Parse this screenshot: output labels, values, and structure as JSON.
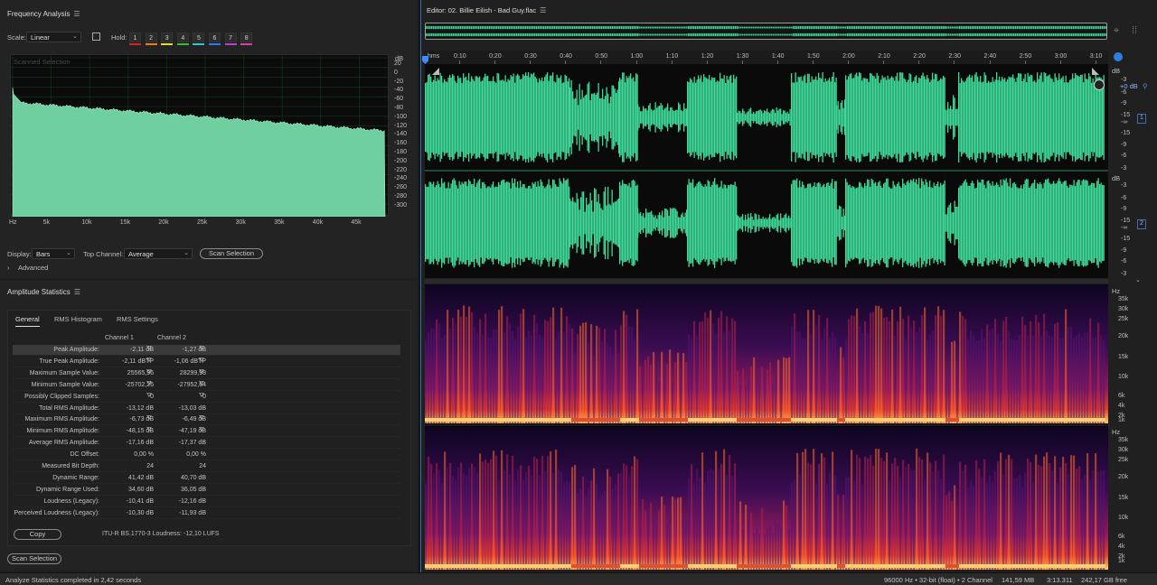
{
  "freq_panel": {
    "title": "Frequency Analysis",
    "scale_label": "Scale:",
    "scale_value": "Linear",
    "hold_label": "Hold:",
    "hold_buttons": [
      "1",
      "2",
      "3",
      "4",
      "5",
      "6",
      "7",
      "8"
    ],
    "hold_colors": [
      "#e02020",
      "#f07d10",
      "#e8e020",
      "#30c030",
      "#2ec8c8",
      "#2e78f0",
      "#c03ce0",
      "#e03ca8"
    ],
    "graph_overlay": "Scanned Selection",
    "db_unit": "dB",
    "db_ticks": [
      "20",
      "0",
      "-20",
      "-40",
      "-60",
      "-80",
      "-100",
      "-120",
      "-140",
      "-160",
      "-180",
      "-200",
      "-220",
      "-240",
      "-260",
      "-280",
      "-300"
    ],
    "freq_ticks": [
      "Hz",
      "5k",
      "10k",
      "15k",
      "20k",
      "25k",
      "30k",
      "35k",
      "40k",
      "45k"
    ],
    "display_label": "Display:",
    "display_value": "Bars",
    "top_channel_label": "Top Channel:",
    "top_channel_value": "Average",
    "scan_button": "Scan Selection",
    "advanced_label": "Advanced"
  },
  "amp_panel": {
    "title": "Amplitude Statistics",
    "tabs": [
      "General",
      "RMS Histogram",
      "RMS Settings"
    ],
    "col1": "Channel 1",
    "col2": "Channel 2",
    "rows": [
      {
        "label": "Peak Amplitude:",
        "c1": "-2,11 dB",
        "c2": "-1,27 dB",
        "arrow": true
      },
      {
        "label": "True Peak Amplitude:",
        "c1": "-2,11 dBTP",
        "c2": "-1,06 dBTP",
        "arrow": true
      },
      {
        "label": "Maximum Sample Value:",
        "c1": "25565,96",
        "c2": "28299,98",
        "arrow": true
      },
      {
        "label": "Minimum Sample Value:",
        "c1": "-25702,26",
        "c2": "-27952,64",
        "arrow": true
      },
      {
        "label": "Possibly Clipped Samples:",
        "c1": "0",
        "c2": "0",
        "arrow": true
      },
      {
        "label": "Total RMS Amplitude:",
        "c1": "-13,12 dB",
        "c2": "-13,03 dB",
        "arrow": false
      },
      {
        "label": "Maximum RMS Amplitude:",
        "c1": "-6,73 dB",
        "c2": "-6,49 dB",
        "arrow": true
      },
      {
        "label": "Minimum RMS Amplitude:",
        "c1": "-48,15 dB",
        "c2": "-47,19 dB",
        "arrow": true
      },
      {
        "label": "Average RMS Amplitude:",
        "c1": "-17,16 dB",
        "c2": "-17,37 dB",
        "arrow": false
      },
      {
        "label": "DC Offset:",
        "c1": "0,00 %",
        "c2": "0,00 %",
        "arrow": false
      },
      {
        "label": "Measured Bit Depth:",
        "c1": "24",
        "c2": "24",
        "arrow": false
      },
      {
        "label": "Dynamic Range:",
        "c1": "41,42 dB",
        "c2": "40,70 dB",
        "arrow": false
      },
      {
        "label": "Dynamic Range Used:",
        "c1": "34,60 dB",
        "c2": "36,05 dB",
        "arrow": false
      },
      {
        "label": "Loudness (Legacy):",
        "c1": "-10,41 dB",
        "c2": "-12,16 dB",
        "arrow": false
      },
      {
        "label": "Perceived Loudness (Legacy):",
        "c1": "-10,30 dB",
        "c2": "-11,93 dB",
        "arrow": false
      }
    ],
    "copy_button": "Copy",
    "loudness_text": "ITU-R BS.1770-3 Loudness: -12,10 LUFS",
    "scan_button": "Scan Selection"
  },
  "editor": {
    "title": "Editor: 02. Billie Eilish - Bad Guy.flac",
    "time_ticks": [
      "hms",
      "0:10",
      "0:20",
      "0:30",
      "0:40",
      "0:50",
      "1:00",
      "1:10",
      "1:20",
      "1:30",
      "1:40",
      "1:50",
      "2:00",
      "2:10",
      "2:20",
      "2:30",
      "2:40",
      "2:50",
      "3:00",
      "3:10"
    ],
    "amp_unit": "dB",
    "amp_ticks": [
      "-3",
      "-6",
      "-9",
      "-15",
      "-∞",
      "-15",
      "-9",
      "-6",
      "-3"
    ],
    "gain_value": "+0 dB",
    "channel_badges": [
      "1",
      "2"
    ],
    "hz_unit": "Hz",
    "spec_ticks": [
      "35k",
      "30k",
      "25k",
      "20k",
      "15k",
      "10k",
      "6k",
      "4k",
      "2k",
      "1k"
    ],
    "accent": "#3fd99a"
  },
  "status": {
    "left": "Analyze Statistics completed in 2,42 seconds",
    "format": "96000 Hz • 32-bit (float) • 2 Channel",
    "size": "141,59 MB",
    "duration": "3:13.311",
    "free": "242,17 GB free"
  }
}
